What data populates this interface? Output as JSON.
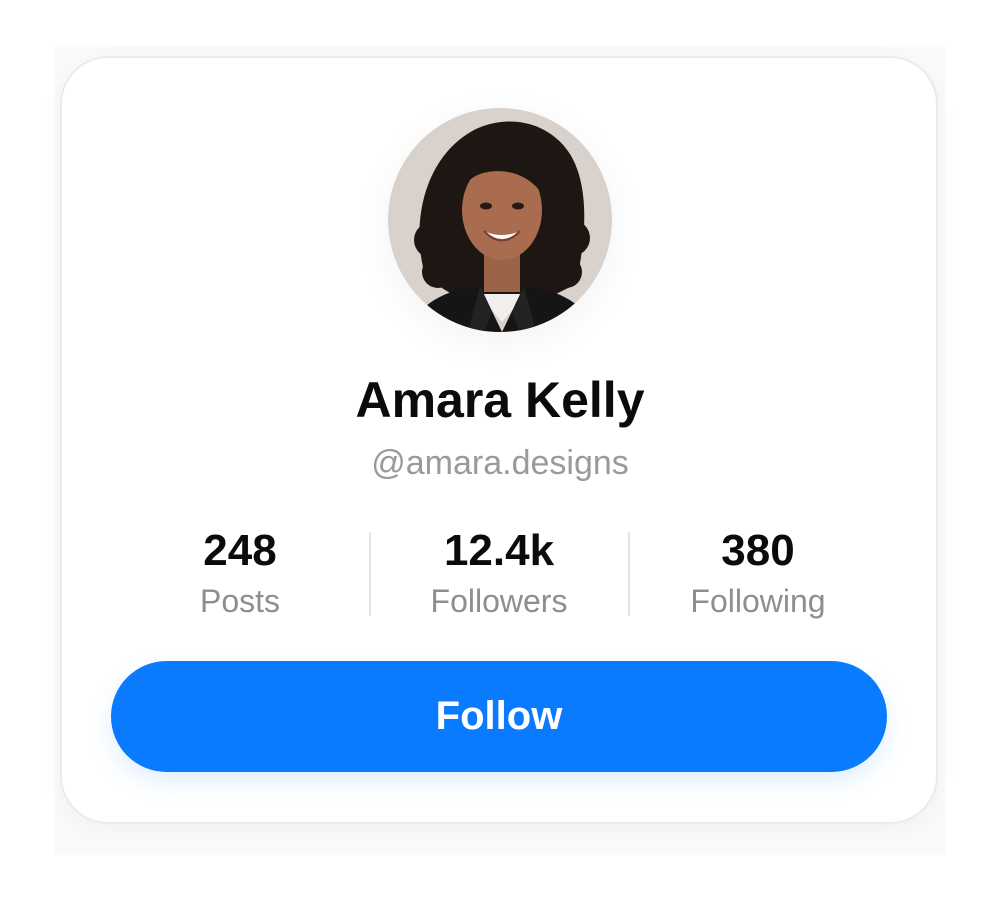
{
  "profile": {
    "name": "Amara Kelly",
    "handle": "@amara.designs"
  },
  "stats": [
    {
      "value": "248",
      "label": "Posts"
    },
    {
      "value": "12.4k",
      "label": "Followers"
    },
    {
      "value": "380",
      "label": "Following"
    }
  ],
  "actions": {
    "follow_label": "Follow"
  },
  "colors": {
    "accent": "#0a7aff",
    "primary_text": "#0b0b0b",
    "secondary_text": "#9a9a9a",
    "divider": "#e4e4e4"
  }
}
